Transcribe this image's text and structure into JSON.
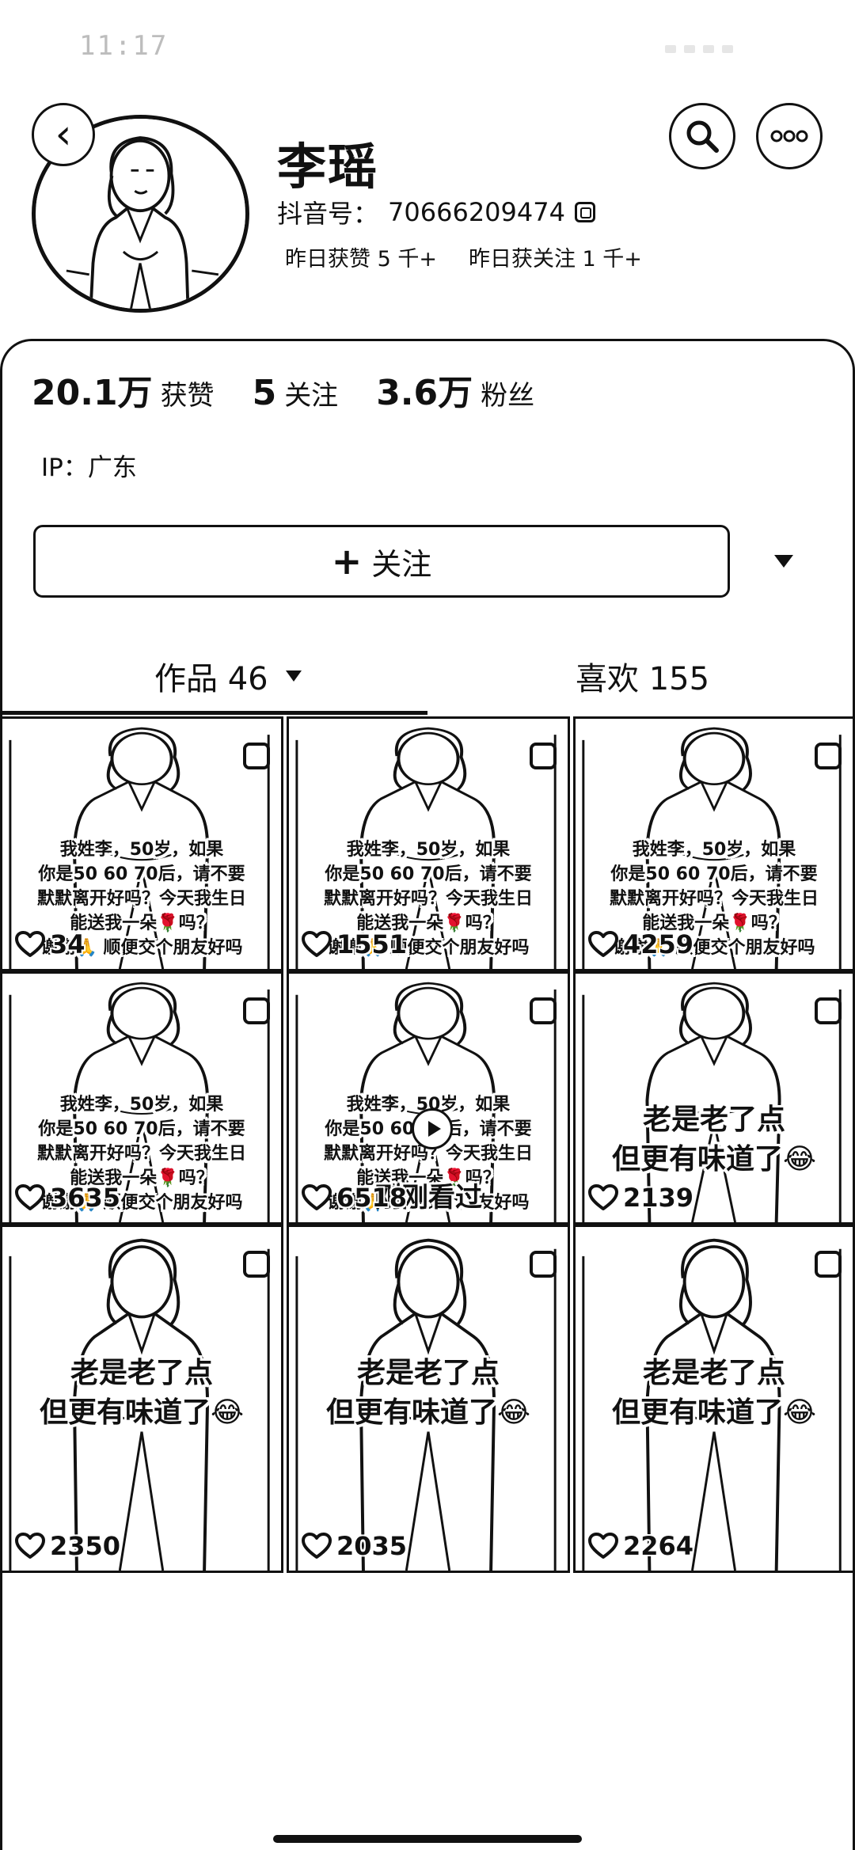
{
  "status_bar": {
    "time": "11:17"
  },
  "profile": {
    "name": "李瑶",
    "douyin_id_label": "抖音号：",
    "douyin_id": "70666209474",
    "yesterday_likes": "昨日获赞 5 千+",
    "yesterday_follows": "昨日获关注 1 千+"
  },
  "stats": {
    "likes_num": "20.1万",
    "likes_label": "获赞",
    "following_num": "5",
    "following_label": "关注",
    "fans_num": "3.6万",
    "fans_label": "粉丝"
  },
  "ip": "IP：广东",
  "follow_button": {
    "plus": "+",
    "label": "关注"
  },
  "tabs": {
    "works": "作品 46",
    "likes": "喜欢 155"
  },
  "videos": [
    {
      "caption": [
        "我姓李，50岁，如果",
        "你是50 60 70后，请不要",
        "默默离开好吗？今天我生日",
        "能送我一朵🌹吗？",
        "谢谢🙏 顺便交个朋友好吗"
      ],
      "likes": "34"
    },
    {
      "caption": [
        "我姓李，50岁，如果",
        "你是50 60 70后，请不要",
        "默默离开好吗？今天我生日",
        "能送我一朵🌹吗？",
        "谢谢🙏 顺便交个朋友好吗"
      ],
      "likes": "1551"
    },
    {
      "caption": [
        "我姓李，50岁，如果",
        "你是50 60 70后，请不要",
        "默默离开好吗？今天我生日",
        "能送我一朵🌹吗？",
        "谢谢🙏 顺便交个朋友好吗"
      ],
      "likes": "4259"
    },
    {
      "caption": [
        "我姓李，50岁，如果",
        "你是50 60 70后，请不要",
        "默默离开好吗？今天我生日",
        "能送我一朵🌹吗？",
        "谢谢🙏 顺便交个朋友好吗"
      ],
      "likes": "3635"
    },
    {
      "caption": [
        "我姓李，50岁，如果",
        "你是50 60 70后，请不要",
        "默默离开好吗？今天我生日",
        "能送我一朵🌹吗？",
        "谢谢🙏 顺便交个朋友好吗"
      ],
      "likes": "6518",
      "overlay": "刚刚看过"
    },
    {
      "caption": [
        "老是老了点",
        "但更有味道了😂"
      ],
      "likes": "2139"
    },
    {
      "caption": [
        "老是老了点",
        "但更有味道了😂"
      ],
      "likes": "2350"
    },
    {
      "caption": [
        "老是老了点",
        "但更有味道了😂"
      ],
      "likes": "2035"
    },
    {
      "caption": [
        "老是老了点",
        "但更有味道了😂"
      ],
      "likes": "2264"
    }
  ]
}
